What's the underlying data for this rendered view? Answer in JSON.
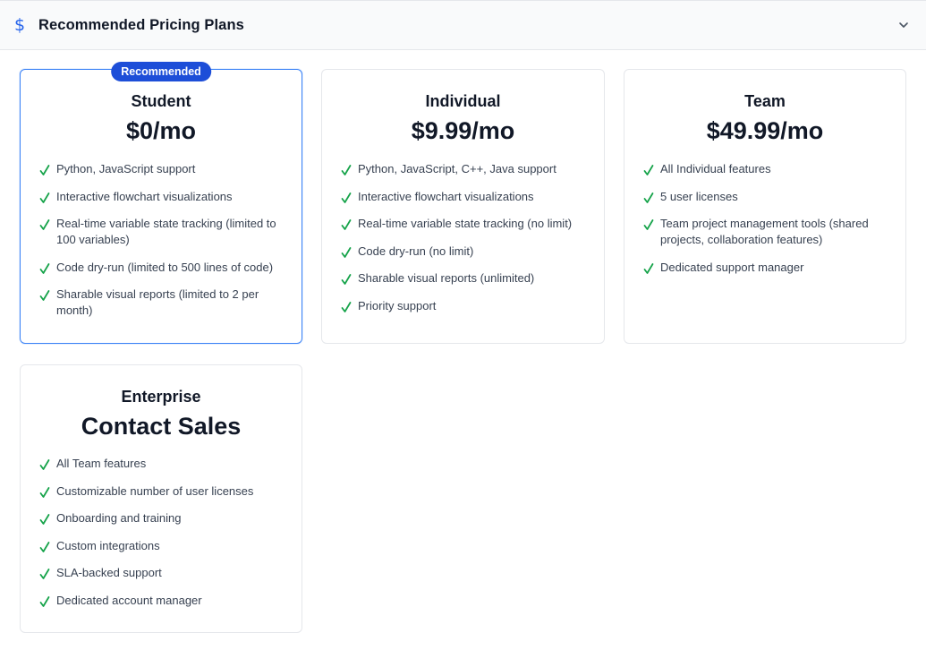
{
  "header": {
    "title": "Recommended Pricing Plans",
    "icon": "dollar-icon",
    "collapse_icon": "chevron-down-icon"
  },
  "colors": {
    "accent": "#2563eb",
    "badge": "#1d4ed8",
    "check": "#16a34a",
    "border": "#e5e7eb"
  },
  "plans": [
    {
      "badge": "Recommended",
      "name": "Student",
      "price": "$0/mo",
      "features": [
        "Python, JavaScript support",
        "Interactive flowchart visualizations",
        "Real-time variable state tracking (limited to 100 variables)",
        "Code dry-run (limited to 500 lines of code)",
        "Sharable visual reports (limited to 2 per month)"
      ]
    },
    {
      "name": "Individual",
      "price": "$9.99/mo",
      "features": [
        "Python, JavaScript, C++, Java support",
        "Interactive flowchart visualizations",
        "Real-time variable state tracking (no limit)",
        "Code dry-run (no limit)",
        "Sharable visual reports (unlimited)",
        "Priority support"
      ]
    },
    {
      "name": "Team",
      "price": "$49.99/mo",
      "features": [
        "All Individual features",
        "5 user licenses",
        "Team project management tools (shared projects, collaboration features)",
        "Dedicated support manager"
      ]
    },
    {
      "name": "Enterprise",
      "price": "Contact Sales",
      "features": [
        "All Team features",
        "Customizable number of user licenses",
        "Onboarding and training",
        "Custom integrations",
        "SLA-backed support",
        "Dedicated account manager"
      ]
    }
  ]
}
